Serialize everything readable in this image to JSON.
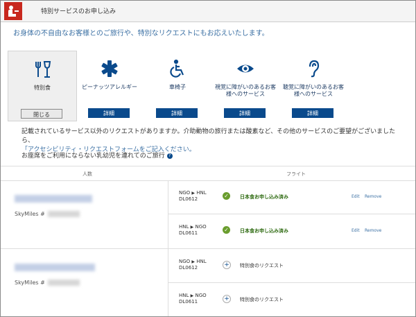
{
  "header": {
    "title": "特別サービスのお申し込み"
  },
  "intro": {
    "text": "お身体の不自由なお客様とのご旅行や、特別なリクエストにもお応えいたします。"
  },
  "tiles": [
    {
      "label": "特別食",
      "button": "閉じる",
      "selected": true,
      "icon": "meal-icon"
    },
    {
      "label": "ピーナッツアレルギー",
      "button": "詳細",
      "selected": false,
      "icon": "medical-star-icon"
    },
    {
      "label": "車椅子",
      "button": "詳細",
      "selected": false,
      "icon": "wheelchair-icon"
    },
    {
      "label": "視覚に障がいのあるお客様へのサービス",
      "button": "詳細",
      "selected": false,
      "icon": "eye-icon"
    },
    {
      "label": "聴覚に障がいのあるお客様へのサービス",
      "button": "詳細",
      "selected": false,
      "icon": "ear-icon"
    }
  ],
  "note": {
    "text": "記載されているサービス以外のリクエストがありますか。介助動物の旅行または酸素など、その他のサービスのご要望がございましたら、",
    "link": "「アクセシビリティ・リクエストフォームをご記入ください。"
  },
  "infant": {
    "text": "お座席をご利用にならない乳幼児を連れてのご旅行"
  },
  "table": {
    "col_passengers": "人数",
    "col_flight": "フライト"
  },
  "passengers": [
    {
      "skymiles_label": "SkyMiles #",
      "segments": [
        {
          "from": "NGO",
          "to": "HNL",
          "flight": "DL0612",
          "status": "日本食お申し込み済み",
          "edit": "Edit",
          "remove": "Remove"
        },
        {
          "from": "HNL",
          "to": "NGO",
          "flight": "DL0611",
          "status": "日本食お申し込み済み",
          "edit": "Edit",
          "remove": "Remove"
        }
      ]
    },
    {
      "skymiles_label": "SkyMiles #",
      "segments": [
        {
          "from": "NGO",
          "to": "HNL",
          "flight": "DL0612",
          "request": "特別食のリクエスト"
        },
        {
          "from": "HNL",
          "to": "NGO",
          "flight": "DL0611",
          "request": "特別食のリクエスト"
        }
      ]
    }
  ],
  "colors": {
    "brand_red": "#c8281e",
    "navy": "#0a4a8c",
    "link_blue": "#3a6fa3",
    "success_green": "#6a9d2e"
  }
}
